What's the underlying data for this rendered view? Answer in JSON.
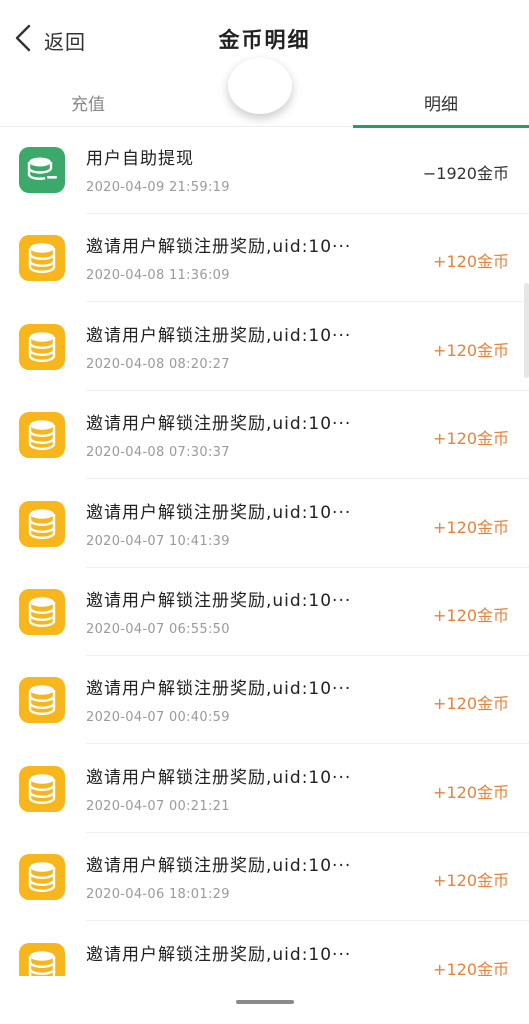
{
  "nav": {
    "back_label": "返回",
    "title": "金币明细"
  },
  "tabs": [
    {
      "label": "充值",
      "active": false
    },
    {
      "label": "",
      "active": false
    },
    {
      "label": "明细",
      "active": true
    }
  ],
  "colors": {
    "accent": "#2f9b5a",
    "positive_amount": "#e8823a",
    "withdraw_icon": "#3aa96a",
    "coin_icon": "#f6b61c"
  },
  "records": [
    {
      "icon": "withdraw-icon",
      "desc": "用户自助提现",
      "time": "2020-04-09 21:59:19",
      "amount": "−1920金币",
      "type": "neg"
    },
    {
      "icon": "coin-stack-icon",
      "desc": "邀请用户解锁注册奖励,uid:10···",
      "time": "2020-04-08 11:36:09",
      "amount": "+120金币",
      "type": "pos"
    },
    {
      "icon": "coin-stack-icon",
      "desc": "邀请用户解锁注册奖励,uid:10···",
      "time": "2020-04-08 08:20:27",
      "amount": "+120金币",
      "type": "pos"
    },
    {
      "icon": "coin-stack-icon",
      "desc": "邀请用户解锁注册奖励,uid:10···",
      "time": "2020-04-08 07:30:37",
      "amount": "+120金币",
      "type": "pos"
    },
    {
      "icon": "coin-stack-icon",
      "desc": "邀请用户解锁注册奖励,uid:10···",
      "time": "2020-04-07 10:41:39",
      "amount": "+120金币",
      "type": "pos"
    },
    {
      "icon": "coin-stack-icon",
      "desc": "邀请用户解锁注册奖励,uid:10···",
      "time": "2020-04-07 06:55:50",
      "amount": "+120金币",
      "type": "pos"
    },
    {
      "icon": "coin-stack-icon",
      "desc": "邀请用户解锁注册奖励,uid:10···",
      "time": "2020-04-07 00:40:59",
      "amount": "+120金币",
      "type": "pos"
    },
    {
      "icon": "coin-stack-icon",
      "desc": "邀请用户解锁注册奖励,uid:10···",
      "time": "2020-04-07 00:21:21",
      "amount": "+120金币",
      "type": "pos"
    },
    {
      "icon": "coin-stack-icon",
      "desc": "邀请用户解锁注册奖励,uid:10···",
      "time": "2020-04-06 18:01:29",
      "amount": "+120金币",
      "type": "pos"
    },
    {
      "icon": "coin-stack-icon",
      "desc": "邀请用户解锁注册奖励,uid:10···",
      "time": "",
      "amount": "+120金币",
      "type": "pos"
    }
  ]
}
